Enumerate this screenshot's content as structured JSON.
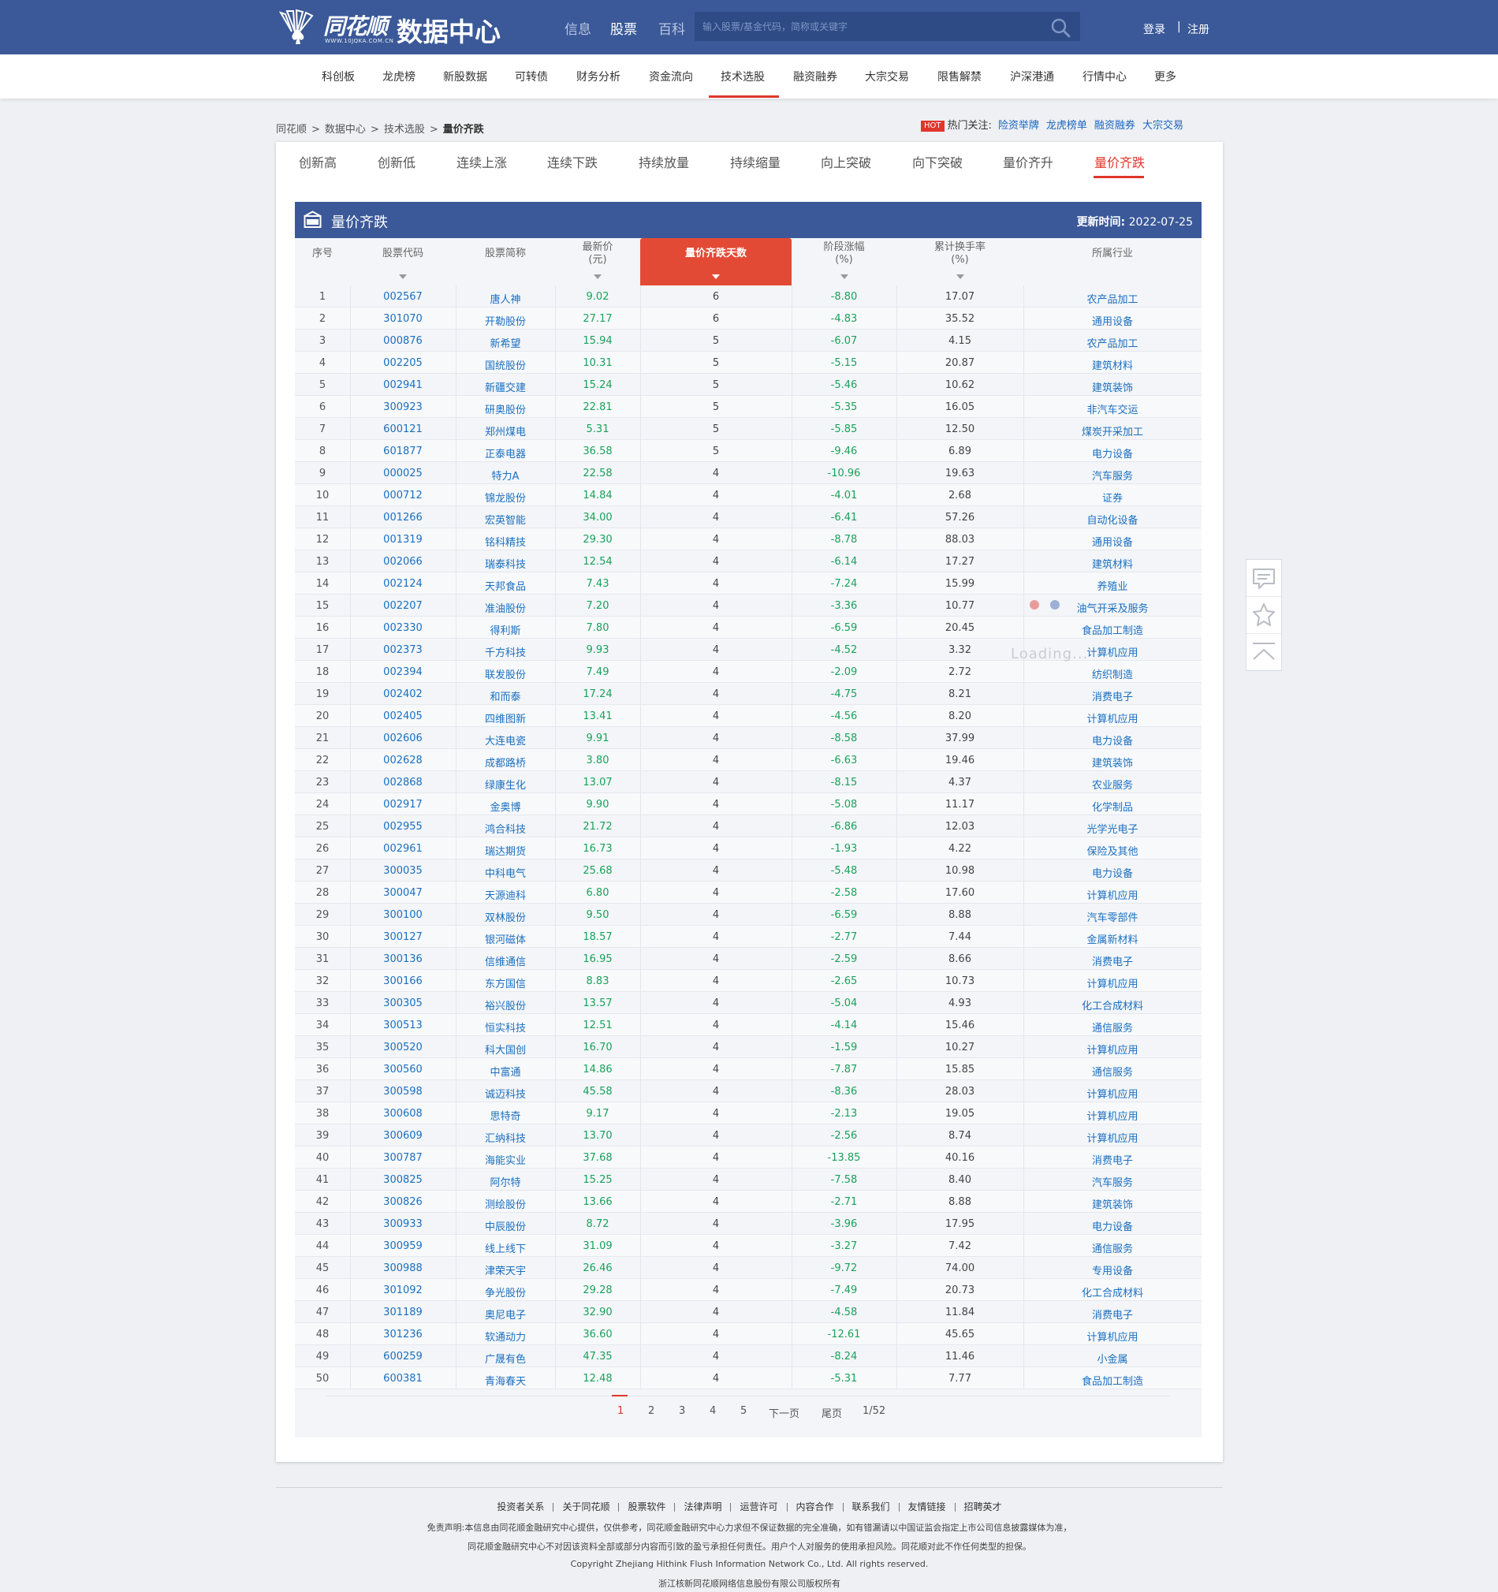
{
  "header": {
    "brand": "同花顺",
    "brand_url": "WWW.10JQKA.COM.CN",
    "site_title": "数据中心",
    "channels": [
      "信息",
      "股票",
      "百科"
    ],
    "active_channel": "股票",
    "search_placeholder": "输入股票/基金代码，简称或关键字",
    "login": "登录",
    "separator": "|",
    "register": "注册",
    "colors": {
      "bar": "#3b5998",
      "accent": "#e0362b",
      "link": "#1a6fc0",
      "down": "#19a25a"
    }
  },
  "nav": {
    "items": [
      "科创板",
      "龙虎榜",
      "新股数据",
      "可转债",
      "财务分析",
      "资金流向",
      "技术选股",
      "融资融券",
      "大宗交易",
      "限售解禁",
      "沪深港通",
      "行情中心",
      "更多"
    ],
    "active": "技术选股"
  },
  "breadcrumb": {
    "items": [
      "同花顺",
      "数据中心",
      "技术选股"
    ],
    "separator": ">",
    "current": "量价齐跌"
  },
  "hot": {
    "badge": "HOT",
    "label": "热门关注:",
    "links": [
      "险资举牌",
      "龙虎榜单",
      "融资融券",
      "大宗交易"
    ]
  },
  "subtabs": {
    "items": [
      "创新高",
      "创新低",
      "连续上涨",
      "连续下跌",
      "持续放量",
      "持续缩量",
      "向上突破",
      "向下突破",
      "量价齐升",
      "量价齐跌"
    ],
    "active": "量价齐跌"
  },
  "panel": {
    "title": "量价齐跌",
    "updated_label": "更新时间:",
    "updated_date": "2022-07-25"
  },
  "table": {
    "columns": [
      {
        "label": "序号",
        "sub": "",
        "sortable": false
      },
      {
        "label": "股票代码",
        "sub": "",
        "sortable": true
      },
      {
        "label": "股票简称",
        "sub": "",
        "sortable": false
      },
      {
        "label": "最新价",
        "sub": "(元)",
        "sortable": true
      },
      {
        "label": "量价齐跌天数",
        "sub": "",
        "sortable": true,
        "sorted": true
      },
      {
        "label": "阶段涨幅",
        "sub": "(%)",
        "sortable": true
      },
      {
        "label": "累计换手率",
        "sub": "(%)",
        "sortable": true
      },
      {
        "label": "所属行业",
        "sub": "",
        "sortable": false
      }
    ],
    "rows": [
      [
        "1",
        "002567",
        "唐人神",
        "9.02",
        "6",
        "-8.80",
        "17.07",
        "农产品加工"
      ],
      [
        "2",
        "301070",
        "开勒股份",
        "27.17",
        "6",
        "-4.83",
        "35.52",
        "通用设备"
      ],
      [
        "3",
        "000876",
        "新希望",
        "15.94",
        "5",
        "-6.07",
        "4.15",
        "农产品加工"
      ],
      [
        "4",
        "002205",
        "国统股份",
        "10.31",
        "5",
        "-5.15",
        "20.87",
        "建筑材料"
      ],
      [
        "5",
        "002941",
        "新疆交建",
        "15.24",
        "5",
        "-5.46",
        "10.62",
        "建筑装饰"
      ],
      [
        "6",
        "300923",
        "研奥股份",
        "22.81",
        "5",
        "-5.35",
        "16.05",
        "非汽车交运"
      ],
      [
        "7",
        "600121",
        "郑州煤电",
        "5.31",
        "5",
        "-5.85",
        "12.50",
        "煤炭开采加工"
      ],
      [
        "8",
        "601877",
        "正泰电器",
        "36.58",
        "5",
        "-9.46",
        "6.89",
        "电力设备"
      ],
      [
        "9",
        "000025",
        "特力A",
        "22.58",
        "4",
        "-10.96",
        "19.63",
        "汽车服务"
      ],
      [
        "10",
        "000712",
        "锦龙股份",
        "14.84",
        "4",
        "-4.01",
        "2.68",
        "证券"
      ],
      [
        "11",
        "001266",
        "宏英智能",
        "34.00",
        "4",
        "-6.41",
        "57.26",
        "自动化设备"
      ],
      [
        "12",
        "001319",
        "铭科精技",
        "29.30",
        "4",
        "-8.78",
        "88.03",
        "通用设备"
      ],
      [
        "13",
        "002066",
        "瑞泰科技",
        "12.54",
        "4",
        "-6.14",
        "17.27",
        "建筑材料"
      ],
      [
        "14",
        "002124",
        "天邦食品",
        "7.43",
        "4",
        "-7.24",
        "15.99",
        "养殖业"
      ],
      [
        "15",
        "002207",
        "准油股份",
        "7.20",
        "4",
        "-3.36",
        "10.77",
        "油气开采及服务"
      ],
      [
        "16",
        "002330",
        "得利斯",
        "7.80",
        "4",
        "-6.59",
        "20.45",
        "食品加工制造"
      ],
      [
        "17",
        "002373",
        "千方科技",
        "9.93",
        "4",
        "-4.52",
        "3.32",
        "计算机应用"
      ],
      [
        "18",
        "002394",
        "联发股份",
        "7.49",
        "4",
        "-2.09",
        "2.72",
        "纺织制造"
      ],
      [
        "19",
        "002402",
        "和而泰",
        "17.24",
        "4",
        "-4.75",
        "8.21",
        "消费电子"
      ],
      [
        "20",
        "002405",
        "四维图新",
        "13.41",
        "4",
        "-4.56",
        "8.20",
        "计算机应用"
      ],
      [
        "21",
        "002606",
        "大连电瓷",
        "9.91",
        "4",
        "-8.58",
        "37.99",
        "电力设备"
      ],
      [
        "22",
        "002628",
        "成都路桥",
        "3.80",
        "4",
        "-6.63",
        "19.46",
        "建筑装饰"
      ],
      [
        "23",
        "002868",
        "绿康生化",
        "13.07",
        "4",
        "-8.15",
        "4.37",
        "农业服务"
      ],
      [
        "24",
        "002917",
        "金奥博",
        "9.90",
        "4",
        "-5.08",
        "11.17",
        "化学制品"
      ],
      [
        "25",
        "002955",
        "鸿合科技",
        "21.72",
        "4",
        "-6.86",
        "12.03",
        "光学光电子"
      ],
      [
        "26",
        "002961",
        "瑞达期货",
        "16.73",
        "4",
        "-1.93",
        "4.22",
        "保险及其他"
      ],
      [
        "27",
        "300035",
        "中科电气",
        "25.68",
        "4",
        "-5.48",
        "10.98",
        "电力设备"
      ],
      [
        "28",
        "300047",
        "天源迪科",
        "6.80",
        "4",
        "-2.58",
        "17.60",
        "计算机应用"
      ],
      [
        "29",
        "300100",
        "双林股份",
        "9.50",
        "4",
        "-6.59",
        "8.88",
        "汽车零部件"
      ],
      [
        "30",
        "300127",
        "银河磁体",
        "18.57",
        "4",
        "-2.77",
        "7.44",
        "金属新材料"
      ],
      [
        "31",
        "300136",
        "信维通信",
        "16.95",
        "4",
        "-2.59",
        "8.66",
        "消费电子"
      ],
      [
        "32",
        "300166",
        "东方国信",
        "8.83",
        "4",
        "-2.65",
        "10.73",
        "计算机应用"
      ],
      [
        "33",
        "300305",
        "裕兴股份",
        "13.57",
        "4",
        "-5.04",
        "4.93",
        "化工合成材料"
      ],
      [
        "34",
        "300513",
        "恒实科技",
        "12.51",
        "4",
        "-4.14",
        "15.46",
        "通信服务"
      ],
      [
        "35",
        "300520",
        "科大国创",
        "16.70",
        "4",
        "-1.59",
        "10.27",
        "计算机应用"
      ],
      [
        "36",
        "300560",
        "中富通",
        "14.86",
        "4",
        "-7.87",
        "15.85",
        "通信服务"
      ],
      [
        "37",
        "300598",
        "诚迈科技",
        "45.58",
        "4",
        "-8.36",
        "28.03",
        "计算机应用"
      ],
      [
        "38",
        "300608",
        "思特奇",
        "9.17",
        "4",
        "-2.13",
        "19.05",
        "计算机应用"
      ],
      [
        "39",
        "300609",
        "汇纳科技",
        "13.70",
        "4",
        "-2.56",
        "8.74",
        "计算机应用"
      ],
      [
        "40",
        "300787",
        "海能实业",
        "37.68",
        "4",
        "-13.85",
        "40.16",
        "消费电子"
      ],
      [
        "41",
        "300825",
        "阿尔特",
        "15.25",
        "4",
        "-7.58",
        "8.40",
        "汽车服务"
      ],
      [
        "42",
        "300826",
        "测绘股份",
        "13.66",
        "4",
        "-2.71",
        "8.88",
        "建筑装饰"
      ],
      [
        "43",
        "300933",
        "中辰股份",
        "8.72",
        "4",
        "-3.96",
        "17.95",
        "电力设备"
      ],
      [
        "44",
        "300959",
        "线上线下",
        "31.09",
        "4",
        "-3.27",
        "7.42",
        "通信服务"
      ],
      [
        "45",
        "300988",
        "津荣天宇",
        "26.46",
        "4",
        "-9.72",
        "74.00",
        "专用设备"
      ],
      [
        "46",
        "301092",
        "争光股份",
        "29.28",
        "4",
        "-7.49",
        "20.73",
        "化工合成材料"
      ],
      [
        "47",
        "301189",
        "奥尼电子",
        "32.90",
        "4",
        "-4.58",
        "11.84",
        "消费电子"
      ],
      [
        "48",
        "301236",
        "软通动力",
        "36.60",
        "4",
        "-12.61",
        "45.65",
        "计算机应用"
      ],
      [
        "49",
        "600259",
        "广晟有色",
        "47.35",
        "4",
        "-8.24",
        "11.46",
        "小金属"
      ],
      [
        "50",
        "600381",
        "青海春天",
        "12.48",
        "4",
        "-5.31",
        "7.77",
        "食品加工制造"
      ]
    ]
  },
  "loading": {
    "text": "Loading...",
    "dot_colors": [
      "#e89c9c",
      "#9db0d6"
    ]
  },
  "pager": {
    "pages": [
      "1",
      "2",
      "3",
      "4",
      "5"
    ],
    "current": "1",
    "next": "下一页",
    "last": "尾页",
    "info": "1/52"
  },
  "side_tools": {
    "icons": [
      "comment-icon",
      "star-icon",
      "back-to-top-icon"
    ]
  },
  "footer": {
    "links": [
      "投资者关系",
      "关于同花顺",
      "股票软件",
      "法律声明",
      "运营许可",
      "内容合作",
      "联系我们",
      "友情链接",
      "招聘英才"
    ],
    "disclaimer1": "免责声明:本信息由同花顺金融研究中心提供，仅供参考，同花顺金融研究中心力求但不保证数据的完全准确，如有错漏请以中国证监会指定上市公司信息披露媒体为准，",
    "disclaimer2": "同花顺金融研究中心不对因该资料全部或部分内容而引致的盈亏承担任何责任。用户个人对服务的使用承担风险。同花顺对此不作任何类型的担保。",
    "copyright": "Copyright Zhejiang Hithink Flush Information Network Co., Ltd. All rights reserved.",
    "company": "浙江核新同花顺网络信息股份有限公司版权所有"
  }
}
